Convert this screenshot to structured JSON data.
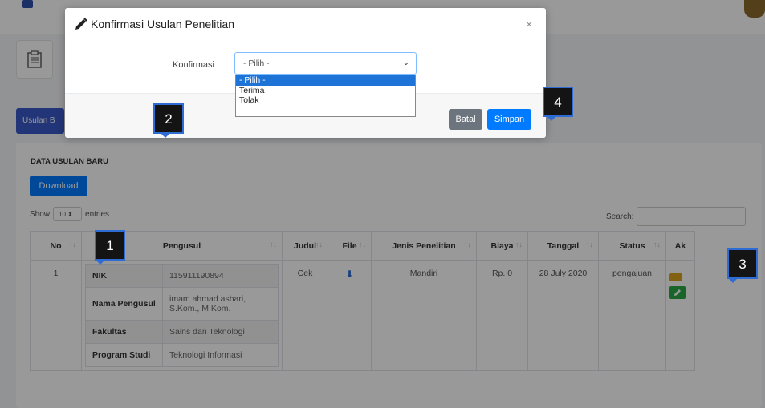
{
  "background": {
    "usulan_button": "Usulan B",
    "card_title": "DATA USULAN BARU",
    "download_button": "Download",
    "show_label": "Show",
    "show_value": "10",
    "entries_label": "entries",
    "search_label": "Search:",
    "table": {
      "headers": [
        "No",
        "Pengusul",
        "Judul",
        "File",
        "Jenis Penelitian",
        "Biaya",
        "Tanggal",
        "Status",
        "Ak"
      ],
      "row": {
        "no": "1",
        "pengusul": [
          {
            "label": "NIK",
            "value": "115911190894"
          },
          {
            "label": "Nama Pengusul",
            "value": "imam ahmad ashari, S.Kom., M.Kom."
          },
          {
            "label": "Fakultas",
            "value": "Sains dan Teknologi"
          },
          {
            "label": "Program Studi",
            "value": "Teknologi Informasi"
          }
        ],
        "judul": "Cek",
        "jenis": "Mandiri",
        "biaya": "Rp. 0",
        "tanggal": "28 July 2020",
        "status": "pengajuan"
      }
    }
  },
  "modal": {
    "title": "Konfirmasi Usulan Penelitian",
    "close": "×",
    "konfirmasi_label": "Konfirmasi",
    "select_value": "- Pilih -",
    "options": [
      "- Pilih -",
      "Terima",
      "Tolak"
    ],
    "batal": "Batal",
    "simpan": "Simpan"
  },
  "callouts": [
    "1",
    "2",
    "3",
    "4"
  ],
  "icons": {
    "edit": "pencil-icon",
    "file": "download-icon",
    "sort": "sort-icon"
  },
  "colors": {
    "primary": "#007bff",
    "secondary": "#6c757d",
    "success": "#28a745",
    "callout_border": "#2e6bd3"
  }
}
